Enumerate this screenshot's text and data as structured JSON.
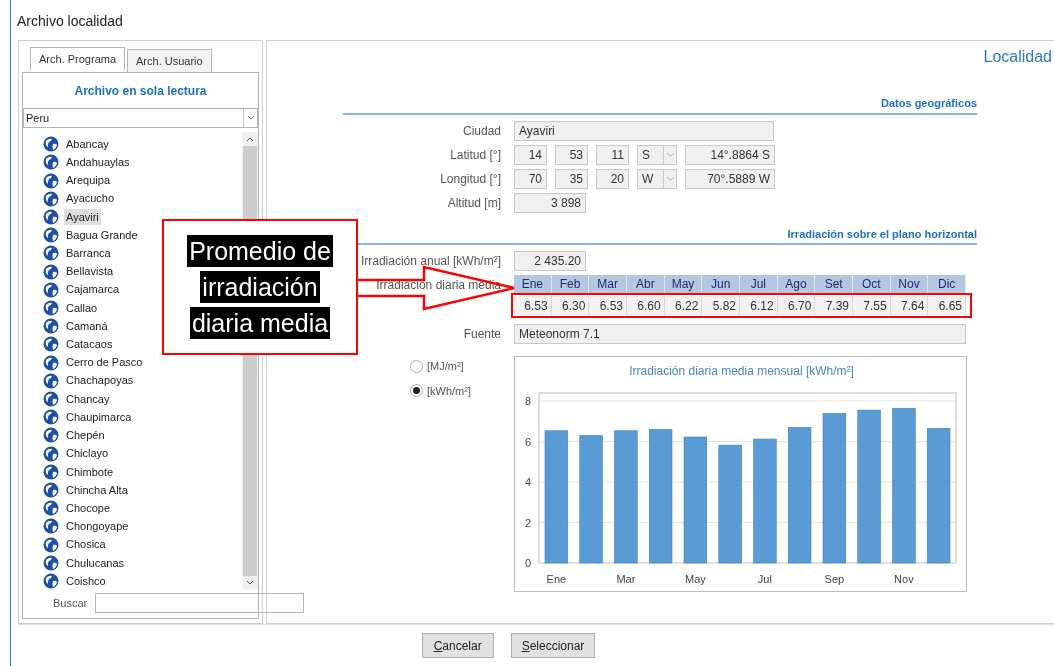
{
  "window": {
    "title": "Archivo localidad"
  },
  "left_panel": {
    "tabs": [
      {
        "label": "Arch. Programa",
        "selected": true
      },
      {
        "label": "Arch. Usuario",
        "selected": false
      }
    ],
    "heading": "Archivo en sola lectura",
    "country": "Peru",
    "cities": [
      {
        "name": "Abancay",
        "selected": false
      },
      {
        "name": "Andahuaylas",
        "selected": false
      },
      {
        "name": "Arequipa",
        "selected": false
      },
      {
        "name": "Ayacucho",
        "selected": false
      },
      {
        "name": "Ayaviri",
        "selected": true
      },
      {
        "name": "Bagua Grande",
        "selected": false
      },
      {
        "name": "Barranca",
        "selected": false
      },
      {
        "name": "Bellavista",
        "selected": false
      },
      {
        "name": "Cajamarca",
        "selected": false
      },
      {
        "name": "Callao",
        "selected": false
      },
      {
        "name": "Camaná",
        "selected": false
      },
      {
        "name": "Catacaos",
        "selected": false
      },
      {
        "name": "Cerro de Pasco",
        "selected": false
      },
      {
        "name": "Chachapoyas",
        "selected": false
      },
      {
        "name": "Chancay",
        "selected": false
      },
      {
        "name": "Chaupimarca",
        "selected": false
      },
      {
        "name": "Chepén",
        "selected": false
      },
      {
        "name": "Chiclayo",
        "selected": false
      },
      {
        "name": "Chimbote",
        "selected": false
      },
      {
        "name": "Chincha Alta",
        "selected": false
      },
      {
        "name": "Chocope",
        "selected": false
      },
      {
        "name": "Chongoyape",
        "selected": false
      },
      {
        "name": "Chosica",
        "selected": false
      },
      {
        "name": "Chulucanas",
        "selected": false
      },
      {
        "name": "Coishco",
        "selected": false
      }
    ],
    "search_label": "Buscar"
  },
  "right_panel": {
    "title": "Localidad",
    "geo": {
      "heading": "Datos geográficos",
      "city": {
        "label": "Ciudad",
        "value": "Ayaviri"
      },
      "coords": [
        {
          "label": "Latitud [°]",
          "deg": "14",
          "min": "53",
          "sec": "11",
          "hemisphere": "S",
          "decimal": "14°.8864 S"
        },
        {
          "label": "Longitud [°]",
          "deg": "70",
          "min": "35",
          "sec": "20",
          "hemisphere": "W",
          "decimal": "70°.5889 W"
        }
      ],
      "altitude": {
        "label": "Altitud [m]",
        "value": "3 898"
      }
    },
    "irradiation": {
      "heading": "Irradiación sobre el plano horizontal",
      "annual": {
        "label": "Irradiación anual [kWh/m²]",
        "value": "2 435.20"
      },
      "daily_label": "Irradiación diaria media",
      "months": [
        "Ene",
        "Feb",
        "Mar",
        "Abr",
        "May",
        "Jun",
        "Jul",
        "Ago",
        "Set",
        "Oct",
        "Nov",
        "Dic"
      ],
      "values": [
        "6.53",
        "6.30",
        "6.53",
        "6.60",
        "6.22",
        "5.82",
        "6.12",
        "6.70",
        "7.39",
        "7.55",
        "7.64",
        "6.65"
      ],
      "source": {
        "label": "Fuente",
        "value": "Meteonorm 7.1"
      },
      "units": [
        {
          "label": "[MJ/m²]",
          "selected": false
        },
        {
          "label": "[kWh/m²]",
          "selected": true
        }
      ],
      "chart_data": {
        "type": "bar",
        "title": "Irradiación diaria media mensual [kWh/m²]",
        "categories": [
          "Ene",
          null,
          "Mar",
          null,
          "May",
          null,
          "Jul",
          null,
          "Sep",
          null,
          "Nov",
          null
        ],
        "series": [
          {
            "color": "#5b9bd5",
            "values": [
              6.53,
              6.3,
              6.53,
              6.6,
              6.22,
              5.82,
              6.12,
              6.7,
              7.39,
              7.55,
              7.64,
              6.65
            ]
          }
        ],
        "ylim": [
          0,
          8
        ],
        "yticks": [
          0,
          2,
          4,
          6,
          8
        ],
        "grid": true
      }
    }
  },
  "buttons": [
    {
      "label": "Cancelar"
    },
    {
      "label": "Seleccionar"
    }
  ],
  "annotation": {
    "lines": [
      "Promedio de",
      "irradiación",
      "diaria media"
    ]
  }
}
